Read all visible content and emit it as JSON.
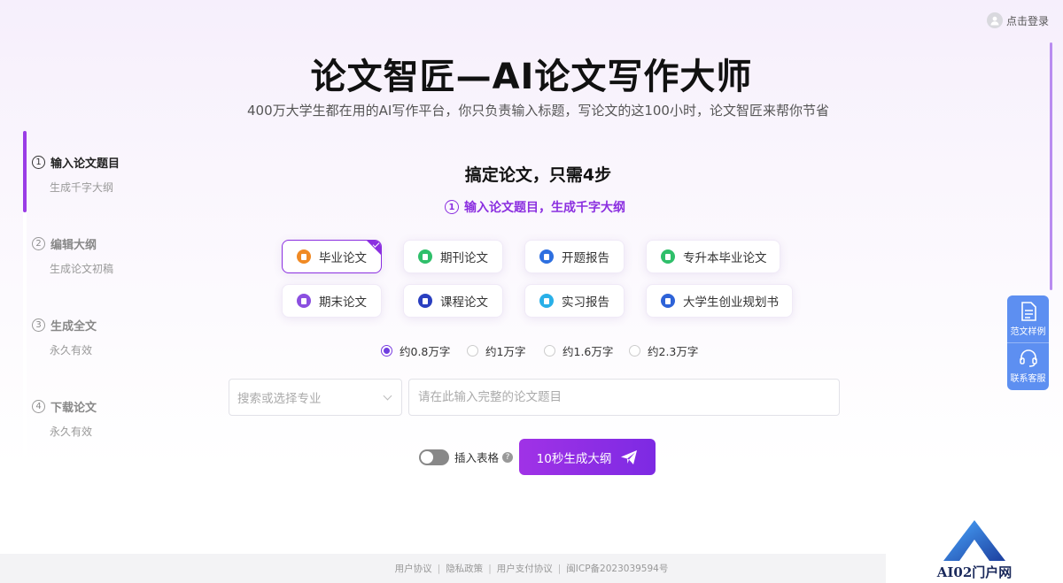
{
  "header": {
    "login_label": "点击登录"
  },
  "hero": {
    "title": "论文智匠—AI论文写作大师",
    "subtitle": "400万大学生都在用的AI写作平台，你只负责输入标题，写论文的这100小时，论文智匠来帮你节省"
  },
  "steps": [
    {
      "num": "1",
      "title": "输入论文题目",
      "desc": "生成千字大纲",
      "active": true
    },
    {
      "num": "2",
      "title": "编辑大纲",
      "desc": "生成论文初稿",
      "active": false
    },
    {
      "num": "3",
      "title": "生成全文",
      "desc": "永久有效",
      "active": false
    },
    {
      "num": "4",
      "title": "下载论文",
      "desc": "永久有效",
      "active": false
    }
  ],
  "main": {
    "heading": "搞定论文，只需4步",
    "current_step_num": "1",
    "current_step_label": "输入论文题目，生成千字大纲"
  },
  "paper_types": [
    {
      "label": "毕业论文",
      "icon": "orange-doc-icon",
      "color": "#f08a24",
      "selected": true
    },
    {
      "label": "期刊论文",
      "icon": "green-doc-icon",
      "color": "#2fbf6a",
      "selected": false
    },
    {
      "label": "开题报告",
      "icon": "blue-report-icon",
      "color": "#2d6fe0",
      "selected": false
    },
    {
      "label": "专升本毕业论文",
      "icon": "green-doc-icon",
      "color": "#2fbf6a",
      "selected": false
    },
    {
      "label": "期末论文",
      "icon": "purple-doc-icon",
      "color": "#8b4fe0",
      "selected": false
    },
    {
      "label": "课程论文",
      "icon": "navy-save-icon",
      "color": "#2a3fc0",
      "selected": false
    },
    {
      "label": "实习报告",
      "icon": "cyan-doc-icon",
      "color": "#29b0e8",
      "selected": false
    },
    {
      "label": "大学生创业规划书",
      "icon": "blue-book-icon",
      "color": "#2e63d8",
      "selected": false
    }
  ],
  "word_counts": [
    {
      "label": "约0.8万字",
      "checked": true
    },
    {
      "label": "约1万字",
      "checked": false
    },
    {
      "label": "约1.6万字",
      "checked": false
    },
    {
      "label": "约2.3万字",
      "checked": false
    }
  ],
  "form": {
    "major_placeholder": "搜索或选择专业",
    "title_placeholder": "请在此输入完整的论文题目",
    "title_value": "",
    "insert_table_label": "插入表格",
    "insert_table_on": false,
    "help_glyph": "?",
    "generate_label": "10秒生成大纲"
  },
  "float_panel": {
    "samples_label": "范文样例",
    "service_label": "联系客服"
  },
  "footer": {
    "links": [
      "用户协议",
      "隐私政策",
      "用户支付协议",
      "闽ICP备2023039594号"
    ]
  },
  "watermark": {
    "text": "AI02门户网"
  },
  "colors": {
    "accent": "#8b2fe0",
    "float_panel": "#5d8ff1"
  }
}
